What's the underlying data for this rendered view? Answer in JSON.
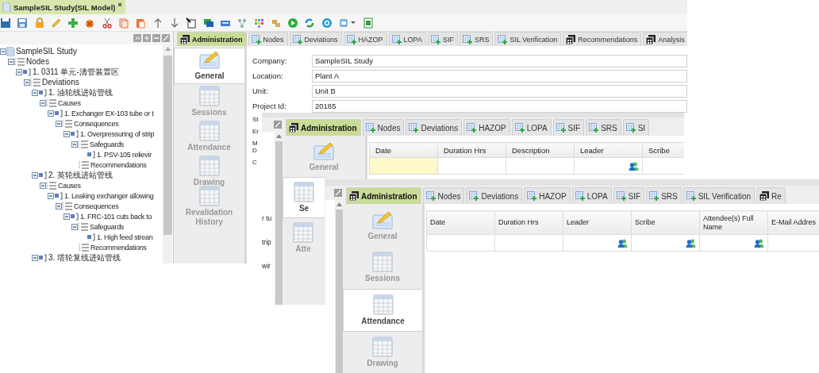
{
  "document_tab": {
    "title": "SampleSIL Study(SIL Model)",
    "close": "×",
    "selected": true
  },
  "tree": [
    {
      "label": "SampleSIL Study",
      "kind": "study",
      "expanded": true,
      "children": [
        {
          "label": "Nodes",
          "kind": "list",
          "expanded": true,
          "children": [
            {
              "label": "1. 0311 单元-清管装置区",
              "kind": "item",
              "expanded": true,
              "children": [
                {
                  "label": "Deviations",
                  "kind": "list",
                  "expanded": true,
                  "children": [
                    {
                      "label": "1. 油轮线进站管线",
                      "kind": "item",
                      "expanded": true,
                      "children": [
                        {
                          "label": "Causes",
                          "kind": "list",
                          "expanded": true,
                          "children": [
                            {
                              "label": "1. Exchanger EX-103 tube or t",
                              "kind": "item",
                              "expanded": true,
                              "children": [
                                {
                                  "label": "Consequences",
                                  "kind": "list",
                                  "expanded": true,
                                  "children": [
                                    {
                                      "label": "1. Overpressuring of strip",
                                      "kind": "item",
                                      "expanded": true,
                                      "children": [
                                        {
                                          "label": "Safeguards",
                                          "kind": "list",
                                          "expanded": true,
                                          "children": [
                                            {
                                              "label": "1. PSV-105 relievir",
                                              "kind": "item"
                                            }
                                          ]
                                        },
                                        {
                                          "label": "Recommendations",
                                          "kind": "list"
                                        }
                                      ]
                                    }
                                  ]
                                }
                              ]
                            }
                          ]
                        }
                      ]
                    },
                    {
                      "label": "2. 英轮线进站管线",
                      "kind": "item",
                      "expanded": true,
                      "children": [
                        {
                          "label": "Causes",
                          "kind": "list",
                          "expanded": true,
                          "children": [
                            {
                              "label": "1. Leaking exchanger allowing",
                              "kind": "item",
                              "expanded": true,
                              "children": [
                                {
                                  "label": "Consequences",
                                  "kind": "list",
                                  "expanded": true,
                                  "children": [
                                    {
                                      "label": "1. FRC-101 cuts back to",
                                      "kind": "item",
                                      "expanded": true,
                                      "children": [
                                        {
                                          "label": "Safeguards",
                                          "kind": "list",
                                          "expanded": true,
                                          "children": [
                                            {
                                              "label": "1. High feed strean",
                                              "kind": "item"
                                            }
                                          ]
                                        },
                                        {
                                          "label": "Recommendations",
                                          "kind": "list"
                                        }
                                      ]
                                    }
                                  ]
                                }
                              ]
                            }
                          ]
                        }
                      ]
                    },
                    {
                      "label": "3. 塔轮复线进站管线",
                      "kind": "item",
                      "expanded": true
                    }
                  ]
                }
              ]
            }
          ]
        }
      ]
    }
  ],
  "views": [
    {
      "kind": "form",
      "tabs": [
        {
          "label": "Administration",
          "kind": "module",
          "selected": true
        },
        {
          "label": "Nodes",
          "kind": "table",
          "selected": false
        },
        {
          "label": "Deviations",
          "kind": "table",
          "selected": false
        },
        {
          "label": "HAZOP",
          "kind": "table",
          "selected": false
        },
        {
          "label": "LOPA",
          "kind": "table",
          "selected": false
        },
        {
          "label": "SIF",
          "kind": "table",
          "selected": false
        },
        {
          "label": "SRS",
          "kind": "table",
          "selected": false
        },
        {
          "label": "SIL Verification",
          "kind": "table",
          "selected": false
        },
        {
          "label": "Recommendations",
          "kind": "module",
          "selected": false
        },
        {
          "label": "Analysis",
          "kind": "module",
          "selected": false
        }
      ],
      "side_nav": [
        {
          "label": "General",
          "kind": "form",
          "selected": true
        },
        {
          "label": "Sessions",
          "kind": "table",
          "selected": false
        },
        {
          "label": "Attendance",
          "kind": "table",
          "selected": false
        },
        {
          "label": "Drawing",
          "kind": "table",
          "selected": false
        },
        {
          "label": "Revalidation History",
          "kind": "table",
          "selected": false
        }
      ],
      "fields": [
        {
          "label": "Company:",
          "value": "SampleSIL Study"
        },
        {
          "label": "Location:",
          "value": "Plant A"
        },
        {
          "label": "Unit:",
          "value": "Unit B"
        },
        {
          "label": "Project Id:",
          "value": "20185"
        }
      ],
      "cut_labels": [
        "St",
        "Er",
        "M D",
        "C"
      ]
    },
    {
      "kind": "grid",
      "tree_fragments": [
        "r tu",
        "trip",
        "wir"
      ],
      "tabs": [
        {
          "label": "Administration",
          "kind": "module",
          "selected": true
        },
        {
          "label": "Nodes",
          "kind": "table",
          "selected": false
        },
        {
          "label": "Deviations",
          "kind": "table",
          "selected": false
        },
        {
          "label": "HAZOP",
          "kind": "table",
          "selected": false
        },
        {
          "label": "LOPA",
          "kind": "table",
          "selected": false
        },
        {
          "label": "SIF",
          "kind": "table",
          "selected": false
        },
        {
          "label": "SRS",
          "kind": "table",
          "selected": false
        },
        {
          "label": "SI",
          "kind": "table",
          "selected": false
        }
      ],
      "side_nav": [
        {
          "label": "General",
          "kind": "form",
          "selected": false
        },
        {
          "label": "Se",
          "kind": "table",
          "selected": true
        },
        {
          "label": "Atte",
          "kind": "table",
          "selected": false
        }
      ],
      "columns": [
        "Date",
        "Duration Hrs",
        "Description",
        "Leader",
        "Scribe"
      ],
      "rows": [
        [
          {
            "kind": "text",
            "selected": true
          },
          {
            "kind": "text",
            "selected": false
          },
          {
            "kind": "text",
            "selected": false
          },
          {
            "kind": "picker",
            "selected": false
          },
          {
            "kind": "text",
            "selected": false
          }
        ]
      ]
    },
    {
      "kind": "grid",
      "tabs": [
        {
          "label": "Administration",
          "kind": "module",
          "selected": true
        },
        {
          "label": "Nodes",
          "kind": "table",
          "selected": false
        },
        {
          "label": "Deviations",
          "kind": "table",
          "selected": false
        },
        {
          "label": "HAZOP",
          "kind": "table",
          "selected": false
        },
        {
          "label": "LOPA",
          "kind": "table",
          "selected": false
        },
        {
          "label": "SIF",
          "kind": "table",
          "selected": false
        },
        {
          "label": "SRS",
          "kind": "table",
          "selected": false
        },
        {
          "label": "SIL Verification",
          "kind": "table",
          "selected": false
        },
        {
          "label": "Re",
          "kind": "module",
          "selected": false
        }
      ],
      "side_nav": [
        {
          "label": "General",
          "kind": "form",
          "selected": false
        },
        {
          "label": "Sessions",
          "kind": "table",
          "selected": false
        },
        {
          "label": "Attendance",
          "kind": "table",
          "selected": true
        },
        {
          "label": "Drawing",
          "kind": "table",
          "selected": false
        }
      ],
      "columns": [
        "Date",
        "Duration Hrs",
        "Leader",
        "Scribe",
        "Attendee(s) Full Name",
        "E-Mail Addres"
      ],
      "rows": [
        [
          {
            "kind": "text",
            "selected": false
          },
          {
            "kind": "text",
            "selected": false
          },
          {
            "kind": "picker",
            "selected": false
          },
          {
            "kind": "picker",
            "selected": false
          },
          {
            "kind": "picker",
            "selected": false
          },
          {
            "kind": "text",
            "selected": false
          }
        ]
      ]
    }
  ]
}
